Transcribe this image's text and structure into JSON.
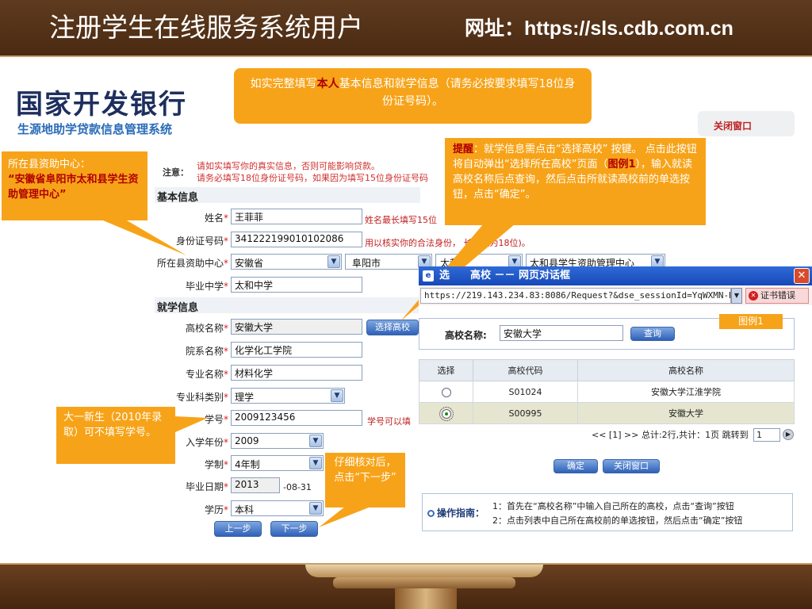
{
  "slide": {
    "title": "注册学生在线服务系统用户",
    "url_label": "网址：https://sls.cdb.com.cn"
  },
  "page": {
    "bank_name": "国家开发银行",
    "system_name": "生源地助学贷款信息管理系统",
    "close_window": "关闭窗口",
    "notice_label": "注意：",
    "notice_line1": "请如实填写你的真实信息，否则可能影响贷款。",
    "notice_line2": "请务必填写18位身份证号码，如果因为填写15位身份证号码",
    "basic_section": "基本信息",
    "school_section": "就学信息",
    "prev_button": "上一步",
    "next_button": "下一步"
  },
  "form": {
    "name": {
      "label": "姓名",
      "value": "王菲菲",
      "hint": "姓名最长填写15位"
    },
    "id_number": {
      "label": "身份证号码",
      "value": "341222199010102086",
      "hint": "用以核实你的合法身份，    长度应为18位)。"
    },
    "funding_center": {
      "label": "所在县资助中心",
      "province": "安徽省",
      "city": "阜阳市",
      "county": "太和",
      "county_2": "太",
      "center": "太和县学生资助管理中心"
    },
    "high_school": {
      "label": "毕业中学",
      "value": "太和中学"
    },
    "college": {
      "label": "高校名称",
      "value": "安徽大学",
      "button": "选择高校"
    },
    "department": {
      "label": "院系名称",
      "value": "化学化工学院"
    },
    "major": {
      "label": "专业名称",
      "value": "材料化学"
    },
    "major_category": {
      "label": "专业科类别",
      "value": "理学"
    },
    "student_id": {
      "label": "学号",
      "value": "2009123456",
      "hint": "学号可以填"
    },
    "enroll_year": {
      "label": "入学年份",
      "value": "2009"
    },
    "duration": {
      "label": "学制",
      "value": "4年制"
    },
    "graduation_date": {
      "label": "毕业日期",
      "year": "2013",
      "suffix": "-08-31"
    },
    "education": {
      "label": "学历",
      "value": "本科"
    }
  },
  "callouts": {
    "top_pre": "如实完整填写",
    "top_red": "本人",
    "top_post": "基本信息和就学信息（请务必按要求填写18位身份证号码）。",
    "left_pre": "所在县资助中心：",
    "left_red": "“安徽省阜阳市太和县学生资助管理中心”",
    "tip_label": "提醒",
    "tip_pre": "：就学信息需点击“选择高校” 按键。 点击此按钮将自动弹出“选择所在高校”页面（",
    "tip_fig": "图例1",
    "tip_post": "），输入就读高校名称后点查询，然后点击所就读高校前的单选按钮，点击“确定”。",
    "freshman": "大一新生（2010年录取）可不填写学号。",
    "check": "仔细核对后，点击“下一步”"
  },
  "dialog": {
    "title": "选择所在高校 -- 网页对话框",
    "title_visible": "选　　高校 －－ 网页对话框",
    "address": "https://219.143.234.83:8086/Request?&dse_sessionId=YqWXMN-HeQW",
    "cert_error": "证书错误",
    "figure_label": "图例1",
    "search_label": "高校名称:",
    "search_value": "安徽大学",
    "query_button": "查询",
    "table_headers": [
      "选择",
      "高校代码",
      "高校名称"
    ],
    "rows": [
      {
        "code": "S01024",
        "name": "安徽大学江淮学院",
        "selected": false
      },
      {
        "code": "S00995",
        "name": "安徽大学",
        "selected": true
      }
    ],
    "pager_text": "<< [1] >> 总计:2行,共计：1页  跳转到",
    "pager_page": "1",
    "ok_button": "确定",
    "close_button": "关闭窗口",
    "guide_label": "操作指南：",
    "guide_line1": "1：首先在“高校名称”中输入自己所在的高校，点击“查询”按钮",
    "guide_line2": "2：点击列表中自己所在高校前的单选按钮，然后点击“确定”按钮"
  },
  "colors": {
    "header_brown": "#5e3b1f",
    "callout_orange": "#f7a319",
    "dialog_blue": "#1648b8"
  }
}
